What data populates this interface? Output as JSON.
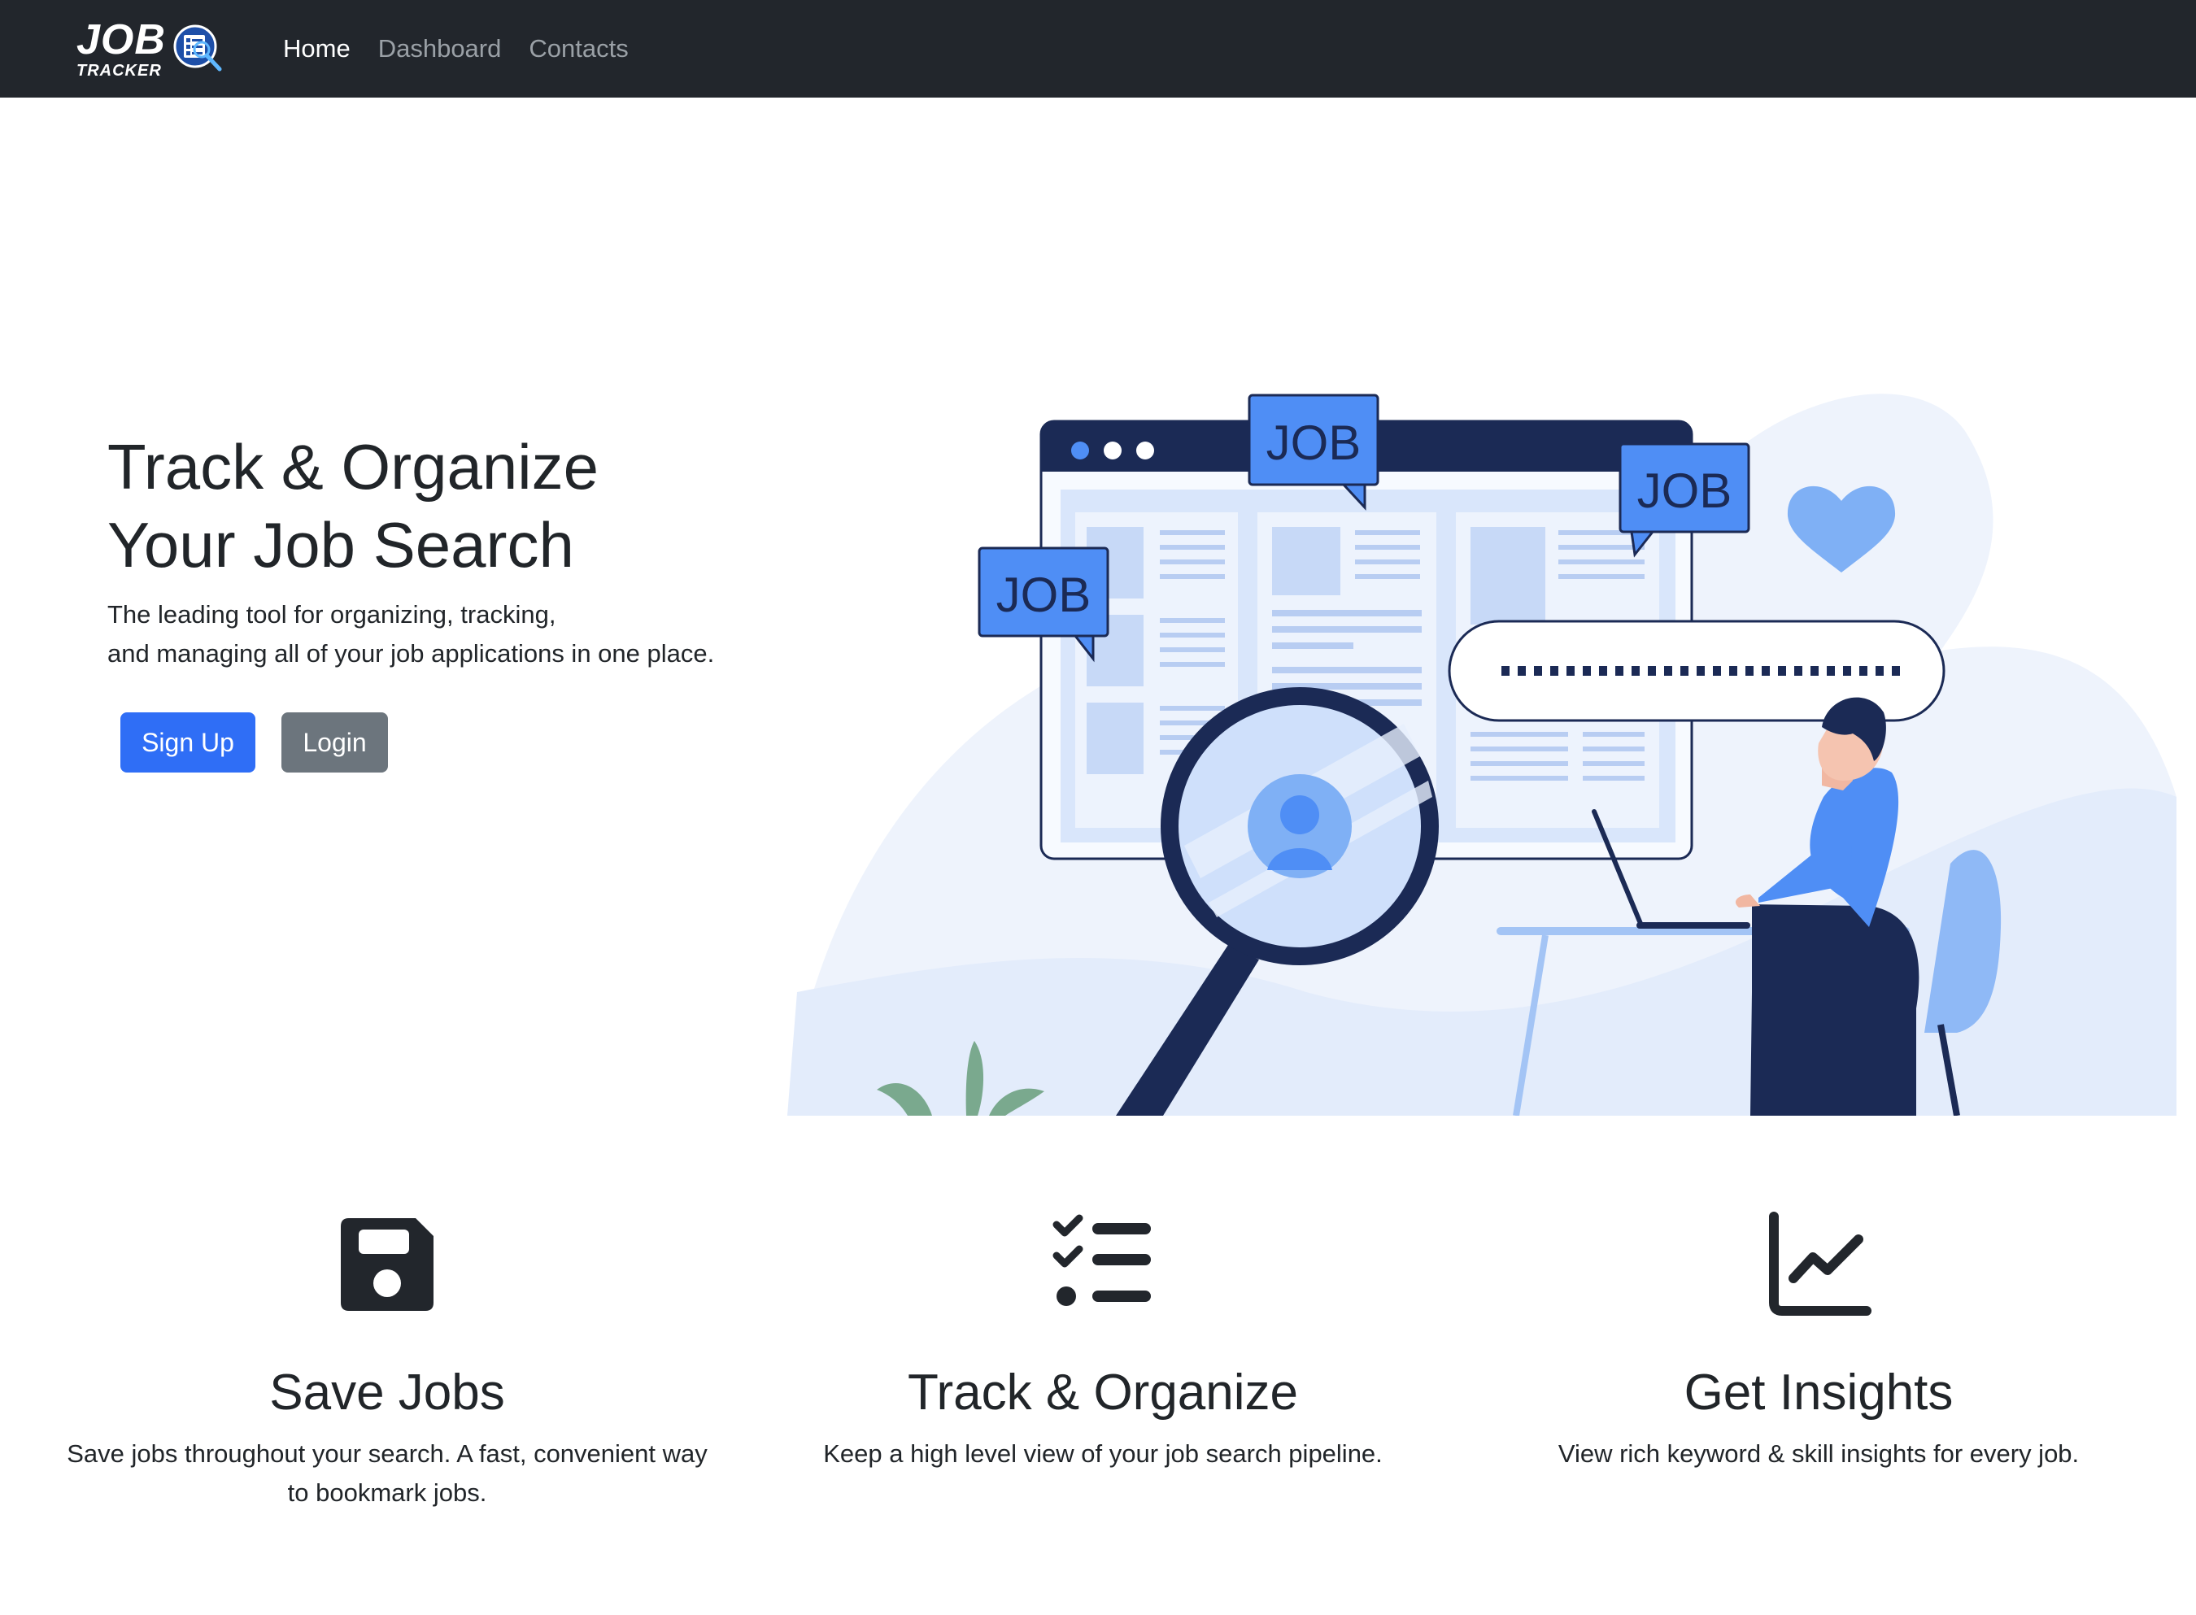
{
  "brand": {
    "line1": "JOB",
    "line2": "TRACKER",
    "logo_icon": "magnifier-document-icon"
  },
  "nav": {
    "items": [
      {
        "label": "Home",
        "active": true
      },
      {
        "label": "Dashboard",
        "active": false
      },
      {
        "label": "Contacts",
        "active": false
      }
    ]
  },
  "hero": {
    "title_line1": "Track & Organize",
    "title_line2": "Your Job Search",
    "subtitle_line1": "The leading tool for organizing, tracking,",
    "subtitle_line2": "and managing all of your job applications in one place.",
    "signup_label": "Sign Up",
    "login_label": "Login",
    "illustration": {
      "bubble_label": "JOB",
      "icon": "job-search-illustration"
    }
  },
  "features": [
    {
      "icon": "floppy-disk-icon",
      "title": "Save Jobs",
      "desc_line1": "Save jobs throughout your search. A fast, convenient way",
      "desc_line2": "to bookmark jobs."
    },
    {
      "icon": "checklist-icon",
      "title": "Track & Organize",
      "desc_line1": "Keep a high level view of your job search pipeline.",
      "desc_line2": ""
    },
    {
      "icon": "line-chart-icon",
      "title": "Get Insights",
      "desc_line1": "View rich keyword & skill insights for every job.",
      "desc_line2": ""
    }
  ],
  "colors": {
    "navbar": "#22262c",
    "primary": "#2f6ef6",
    "secondary": "#6c757d",
    "illustration_navy": "#1b2a55",
    "illustration_blue": "#4f8ef5",
    "illustration_light": "#eef3fc"
  }
}
